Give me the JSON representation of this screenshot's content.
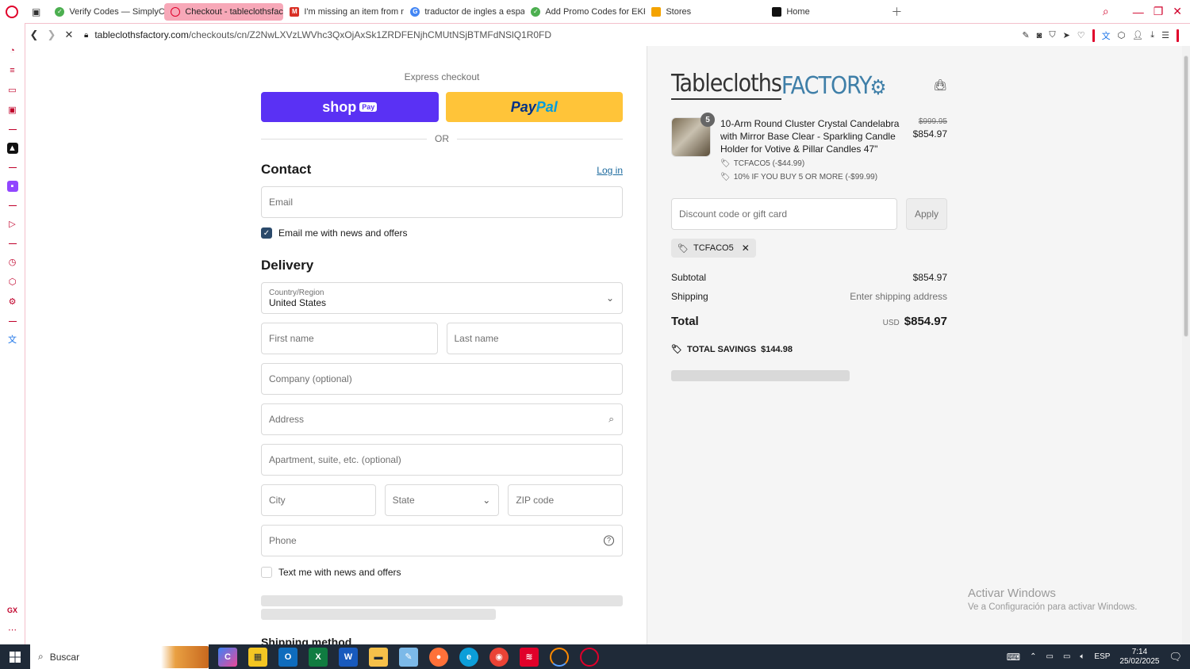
{
  "browser": {
    "tabs": [
      {
        "label": "Verify Codes — SimplyCo",
        "favicon_color": "#4caf50",
        "active": false
      },
      {
        "label": "Checkout - tableclothsfac",
        "favicon_color": "#e0002a",
        "active": true
      },
      {
        "label": "I'm missing an item from m",
        "favicon_color": "#d93025",
        "active": false
      },
      {
        "label": "traductor de ingles a espa",
        "favicon_color": "#4285f4",
        "active": false
      },
      {
        "label": "Add Promo Codes for EKR",
        "favicon_color": "#4caf50",
        "active": false
      },
      {
        "label": "Stores",
        "favicon_color": "#f4a300",
        "active": false
      },
      {
        "label": "Home",
        "favicon_color": "#111111",
        "active": false
      }
    ],
    "url_host": "tableclothsfactory.com",
    "url_path": "/checkouts/cn/Z2NwLXVzLWVhc3QxOjAxSk1ZRDFENjhCMUtNSjBTMFdNSlQ1R0FD"
  },
  "checkout": {
    "express_label": "Express checkout",
    "shop_label": "shop",
    "shop_badge": "Pay",
    "paypal_p1": "Pay",
    "paypal_p2": "Pal",
    "or_label": "OR",
    "contact_title": "Contact",
    "login_link": "Log in",
    "email_placeholder": "Email",
    "email_news_label": "Email me with news and offers",
    "delivery_title": "Delivery",
    "country_label": "Country/Region",
    "country_value": "United States",
    "first_name": "First name",
    "last_name": "Last name",
    "company": "Company (optional)",
    "address": "Address",
    "apartment": "Apartment, suite, etc. (optional)",
    "city": "City",
    "state": "State",
    "zip": "ZIP code",
    "phone": "Phone",
    "text_news_label": "Text me with news and offers",
    "shipping_method_title": "Shipping method"
  },
  "summary": {
    "logo_part1": "Tablecloths",
    "logo_part2": "FACTORY",
    "item_qty": "5",
    "item_title": "10-Arm Round Cluster Crystal Candelabra with Mirror Base Clear - Sparkling Candle Holder for Votive & Pillar Candles 47\"",
    "item_discount_1": "TCFACO5 (-$44.99)",
    "item_discount_2": "10% IF YOU BUY 5 OR MORE (-$99.99)",
    "item_price_old": "$999.95",
    "item_price_new": "$854.97",
    "discount_placeholder": "Discount code or gift card",
    "apply_label": "Apply",
    "applied_code": "TCFACO5",
    "subtotal_label": "Subtotal",
    "subtotal_value": "$854.97",
    "shipping_label": "Shipping",
    "shipping_value": "Enter shipping address",
    "total_label": "Total",
    "total_currency": "USD",
    "total_value": "$854.97",
    "savings_label": "TOTAL SAVINGS",
    "savings_value": "$144.98"
  },
  "windows": {
    "activate_title": "Activar Windows",
    "activate_sub": "Ve a Configuración para activar Windows.",
    "search_label": "Buscar",
    "lang": "ESP",
    "time": "7:14",
    "date": "25/02/2025"
  }
}
